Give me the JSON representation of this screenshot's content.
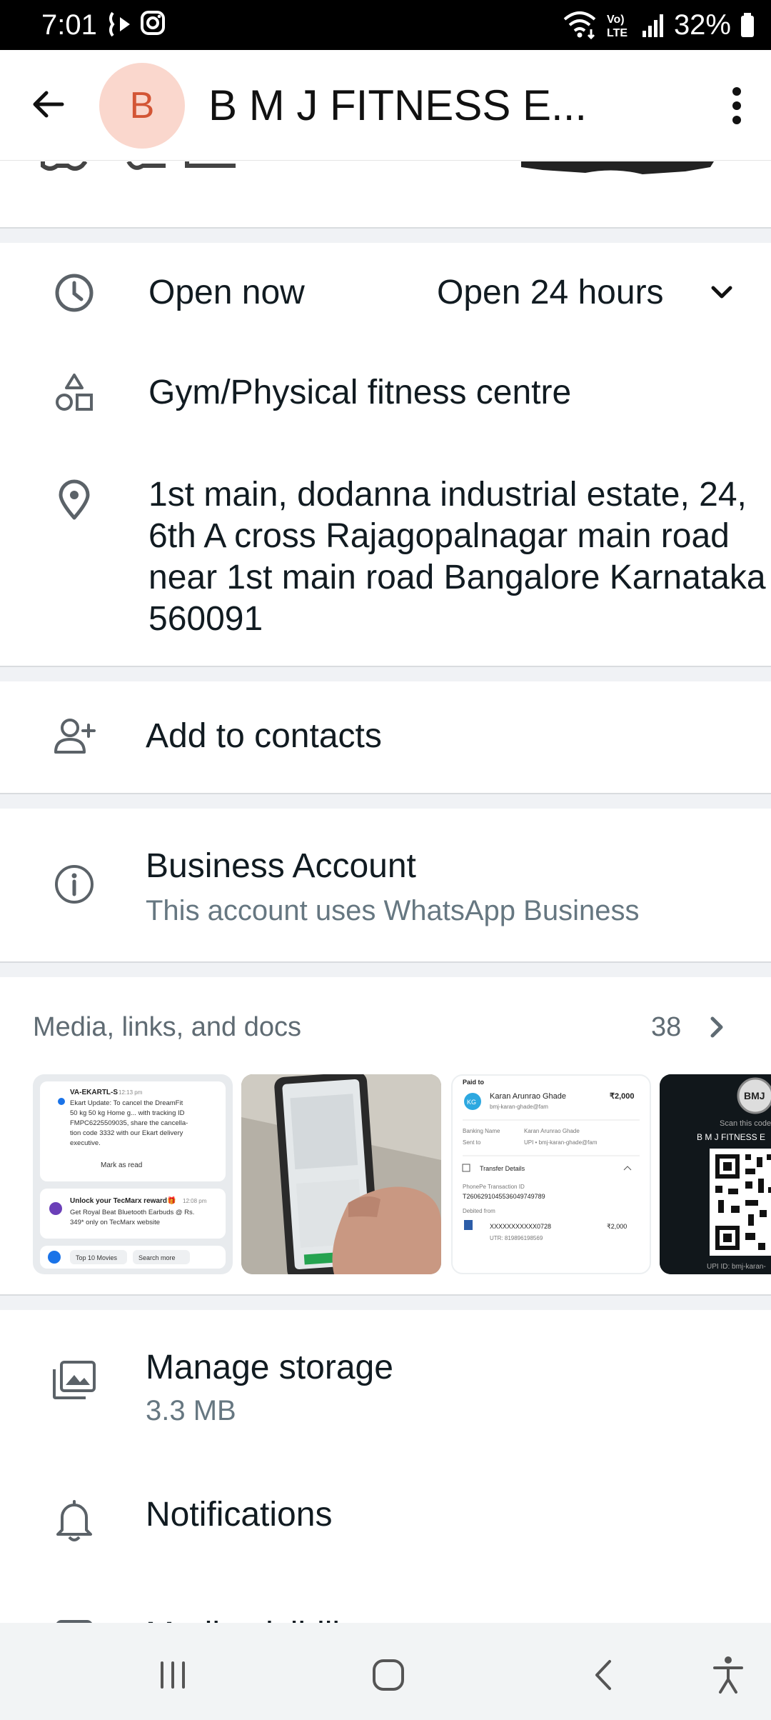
{
  "status_bar": {
    "time": "7:01",
    "battery": "32%",
    "network": "VoLTE",
    "left_icons": [
      "talkback-icon",
      "instagram-icon"
    ],
    "right_icons": [
      "wifi-icon",
      "volte-icon",
      "signal-icon",
      "battery-icon"
    ]
  },
  "header": {
    "avatar_letter": "B",
    "title": "B M J FITNESS E...",
    "avatar_color": "#fad7cd",
    "avatar_text_color": "#d35535"
  },
  "info": {
    "open_status": "Open now",
    "hours": "Open 24 hours",
    "category": "Gym/Physical fitness centre",
    "address": "1st main, dodanna industrial estate, 24, 6th A cross Rajagopalnagar main road near 1st main road Bangalore Karnataka 560091",
    "open_color": "#25a350",
    "link_color": "#1a63c4"
  },
  "contacts": {
    "add_label": "Add to contacts"
  },
  "business": {
    "title": "Business Account",
    "subtitle": "This account uses WhatsApp Business"
  },
  "media": {
    "header": "Media, links, and docs",
    "count": "38",
    "thumbs": [
      {
        "kind": "notification-screenshot",
        "sender": "VA-EKARTL-S",
        "time": "12:13 pm",
        "text": "Ekart Update: To cancel the DreamFit 50 kg 50 kg Home g... with tracking ID FMPC6225509035, share the cancella-tion code 3332 with our Ekart delivery executive.",
        "action": "Mark as read",
        "promo_title": "Unlock your TecMarx reward🎁",
        "promo_time": "12:08 pm",
        "promo_text": "Get Royal Beat Bluetooth Earbuds @ Rs. 349* only on TecMarx website",
        "chip1": "Top 10 Movies",
        "chip2": "Search more"
      },
      {
        "kind": "photo-phone"
      },
      {
        "kind": "payment-screenshot",
        "paid_to": "Paid to",
        "initials": "KG",
        "name": "Karan Arunrao Ghade",
        "amount": "₹2,000",
        "upi": "bmj-karan-ghade@fam",
        "banking_name_label": "Banking Name",
        "banking_name": "Karan Arunrao Ghade",
        "sent_to_label": "Sent to",
        "sent_to": "UPI • bmj-karan-ghade@fam",
        "transfer_details": "Transfer Details",
        "txn_label": "PhonePe Transaction ID",
        "txn_id": "T2606291045536049749789",
        "debited_label": "Debited from",
        "account": "XXXXXXXXXXX0728",
        "account_amount": "₹2,000",
        "utr": "UTR: 819896198569"
      },
      {
        "kind": "qr-code",
        "logo_text": "BMJ",
        "scan_text": "Scan this code",
        "business_name": "B M J FITNESS E",
        "upi_id": "UPI ID: bmj-karan-"
      }
    ]
  },
  "storage": {
    "title": "Manage storage",
    "size": "3.3 MB"
  },
  "notifications": {
    "title": "Notifications"
  },
  "partial_row": {
    "title": "Media visibility"
  }
}
